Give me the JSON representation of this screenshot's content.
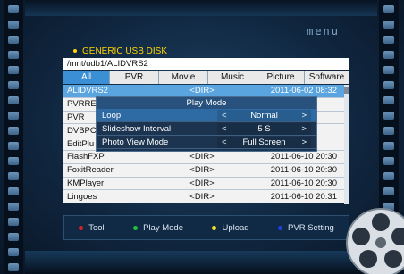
{
  "header": {
    "menu_label": "menu",
    "source": "GENERIC USB DISK",
    "path": "/mnt/udb1/ALIDVRS2"
  },
  "tabs": [
    {
      "label": "All",
      "active": true
    },
    {
      "label": "PVR",
      "active": false
    },
    {
      "label": "Movie",
      "active": false
    },
    {
      "label": "Music",
      "active": false
    },
    {
      "label": "Picture",
      "active": false
    },
    {
      "label": "Software",
      "active": false
    }
  ],
  "files": [
    {
      "name": "ALIDVRS2",
      "type": "<DIR>",
      "date": "2011-06-02 08:32",
      "selected": true
    },
    {
      "name": "PVRRE\\",
      "type": "",
      "date": "",
      "selected": false
    },
    {
      "name": "PVR",
      "type": "",
      "date": "",
      "selected": false
    },
    {
      "name": "DVBPC",
      "type": "",
      "date": "",
      "selected": false
    },
    {
      "name": "EditPlu",
      "type": "",
      "date": "",
      "selected": false
    },
    {
      "name": "FlashFXP",
      "type": "<DIR>",
      "date": "2011-06-10 20:30",
      "selected": false
    },
    {
      "name": "FoxitReader",
      "type": "<DIR>",
      "date": "2011-06-10 20:30",
      "selected": false
    },
    {
      "name": "KMPlayer",
      "type": "<DIR>",
      "date": "2011-06-10 20:30",
      "selected": false
    },
    {
      "name": "Lingoes",
      "type": "<DIR>",
      "date": "2011-06-10 20:31",
      "selected": false
    }
  ],
  "popup": {
    "title": "Play Mode",
    "options": [
      {
        "label": "Loop",
        "value": "Normal",
        "focused": true
      },
      {
        "label": "Slideshow Interval",
        "value": "5 S",
        "focused": false
      },
      {
        "label": "Photo View Mode",
        "value": "Full Screen",
        "focused": false
      }
    ],
    "arrow_left": "<",
    "arrow_right": ">"
  },
  "hints": [
    {
      "label": "Tool",
      "color": "#e02020"
    },
    {
      "label": "Play Mode",
      "color": "#22c03a"
    },
    {
      "label": "Upload",
      "color": "#f0e020"
    },
    {
      "label": "PVR Setting",
      "color": "#2040e0"
    }
  ],
  "colors": {
    "accent": "#3b8fd4",
    "selected_row": "#5aa4df",
    "title_yellow": "#ffd400"
  },
  "icons": {
    "reel": "film-reel-icon"
  }
}
